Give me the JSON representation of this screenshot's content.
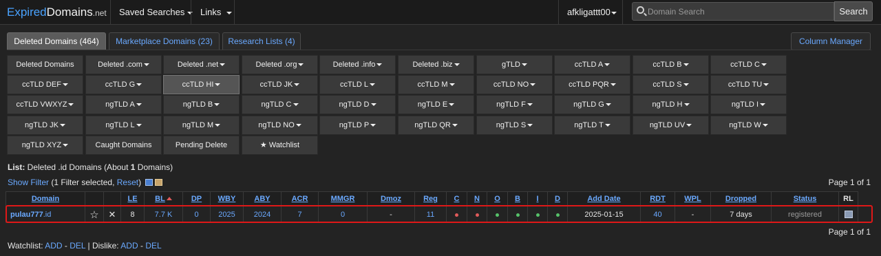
{
  "nav": {
    "brand_part1": "Expired",
    "brand_part2": "Domains",
    "brand_part3": ".net",
    "saved_searches": "Saved Searches",
    "links": "Links",
    "user": "afkligattt00",
    "search_placeholder": "Domain Search",
    "search_button": "Search"
  },
  "tabs": [
    {
      "label": "Deleted Domains (464)",
      "active": true
    },
    {
      "label": "Marketplace Domains (23)",
      "active": false
    },
    {
      "label": "Research Lists (4)",
      "active": false
    }
  ],
  "column_manager": "Column Manager",
  "filters": [
    [
      "Deleted Domains",
      "Deleted .com",
      "Deleted .net",
      "Deleted .org",
      "Deleted .info",
      "Deleted .biz",
      "gTLD",
      "ccTLD A",
      "ccTLD B",
      "ccTLD C"
    ],
    [
      "ccTLD DEF",
      "ccTLD G",
      "ccTLD HI",
      "ccTLD JK",
      "ccTLD L",
      "ccTLD M",
      "ccTLD NO",
      "ccTLD PQR",
      "ccTLD S",
      "ccTLD TU"
    ],
    [
      "ccTLD VWXYZ",
      "ngTLD A",
      "ngTLD B",
      "ngTLD C",
      "ngTLD D",
      "ngTLD E",
      "ngTLD F",
      "ngTLD G",
      "ngTLD H",
      "ngTLD I"
    ],
    [
      "ngTLD JK",
      "ngTLD L",
      "ngTLD M",
      "ngTLD NO",
      "ngTLD P",
      "ngTLD QR",
      "ngTLD S",
      "ngTLD T",
      "ngTLD UV",
      "ngTLD W"
    ],
    [
      "ngTLD XYZ",
      "Caught Domains",
      "Pending Delete",
      "★ Watchlist"
    ]
  ],
  "filters_no_caret": [
    "Deleted Domains",
    "Caught Domains",
    "Pending Delete",
    "★ Watchlist"
  ],
  "active_filter": "ccTLD HI",
  "list": {
    "label": "List:",
    "text_before": " Deleted .id Domains (About ",
    "count": "1",
    "text_after": " Domains)"
  },
  "filter_line": {
    "show_filter": "Show Filter",
    "selected_text": " (1 Filter selected, ",
    "reset": "Reset",
    "close_paren": ")"
  },
  "page_info": "Page 1 of 1",
  "table": {
    "headers": [
      "Domain",
      "",
      "",
      "LE",
      "BL",
      "DP",
      "WBY",
      "ABY",
      "ACR",
      "MMGR",
      "Dmoz",
      "Reg",
      "C",
      "N",
      "O",
      "B",
      "I",
      "D",
      "Add Date",
      "RDT",
      "WPL",
      "Dropped",
      "Status",
      "RL"
    ],
    "row": {
      "domain_name": "pulau777",
      "domain_tld": ".id",
      "star": "☆",
      "x": "✕",
      "le": "8",
      "bl": "7.7 K",
      "dp": "0",
      "wby": "2025",
      "aby": "2024",
      "acr": "7",
      "mmgr": "0",
      "dmoz": "-",
      "reg": "11",
      "c": "red",
      "n": "red",
      "o": "green",
      "b": "green",
      "i": "green",
      "d": "green",
      "add_date": "2025-01-15",
      "rdt": "40",
      "wpl": "-",
      "dropped": "7 days",
      "status": "registered"
    }
  },
  "watchlist": {
    "label": "Watchlist: ",
    "add": "ADD",
    "dash": " - ",
    "del": "DEL",
    "sep": " | Dislike: ",
    "add2": "ADD",
    "dash2": " - ",
    "del2": "DEL"
  },
  "colors": {
    "dot_red": "#e05a5a",
    "dot_green": "#56c26a",
    "accent": "#6aa9ff"
  }
}
